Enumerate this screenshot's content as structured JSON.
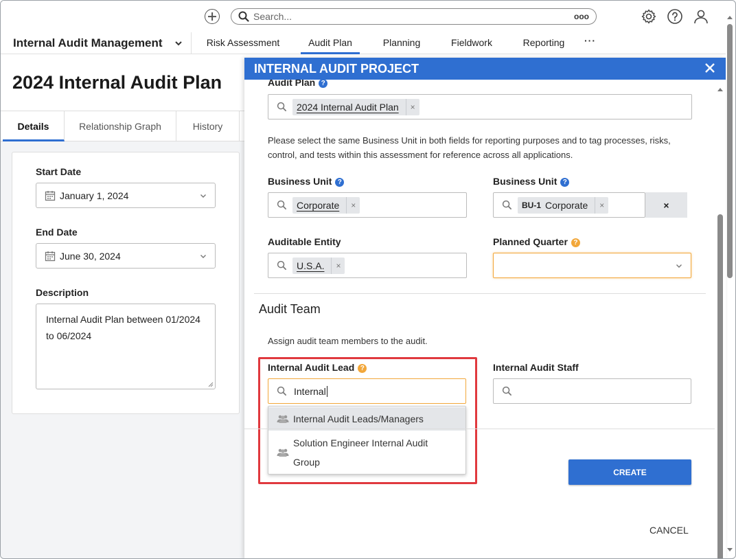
{
  "topbar": {
    "search_placeholder": "Search...",
    "search_more": "ooo"
  },
  "nav": {
    "app_name": "Internal Audit Management",
    "tabs": [
      "Risk Assessment",
      "Audit Plan",
      "Planning",
      "Fieldwork",
      "Reporting"
    ],
    "active_tab": "Audit Plan",
    "more": "···"
  },
  "page": {
    "title": "2024 Internal Audit Plan",
    "tabs": [
      "Details",
      "Relationship Graph",
      "History"
    ],
    "active_tab": "Details",
    "start_date_label": "Start Date",
    "start_date": "January 1, 2024",
    "end_date_label": "End Date",
    "end_date": "June 30, 2024",
    "description_label": "Description",
    "description": "Internal Audit Plan between 01/2024 to 06/2024"
  },
  "modal": {
    "title": "INTERNAL AUDIT PROJECT",
    "audit_plan_label": "Audit Plan",
    "audit_plan_value": "2024 Internal Audit Plan",
    "business_unit_note": "Please select the same Business Unit in both fields for reporting purposes and to tag processes, risks, control, and tests within this assessment for reference across all applications.",
    "business_unit_label_1": "Business Unit",
    "business_unit_value_1": "Corporate",
    "business_unit_label_2": "Business Unit",
    "business_unit_code_2": "BU-1",
    "business_unit_value_2": "Corporate",
    "clear_symbol": "×",
    "auditable_entity_label": "Auditable Entity",
    "auditable_entity_value": "U.S.A.",
    "planned_quarter_label": "Planned Quarter",
    "audit_team_title": "Audit Team",
    "audit_team_note": "Assign audit team members to the audit.",
    "lead_label": "Internal Audit Lead",
    "lead_input_value": "Internal",
    "staff_label": "Internal Audit Staff",
    "dropdown_options": [
      "Internal Audit Leads/Managers",
      "Solution Engineer Internal Audit Group"
    ],
    "create_label": "CREATE",
    "cancel_label": "CANCEL"
  },
  "colors": {
    "accent": "#2f6fd1",
    "focus": "#f2a73a",
    "highlight": "#e0393e"
  }
}
